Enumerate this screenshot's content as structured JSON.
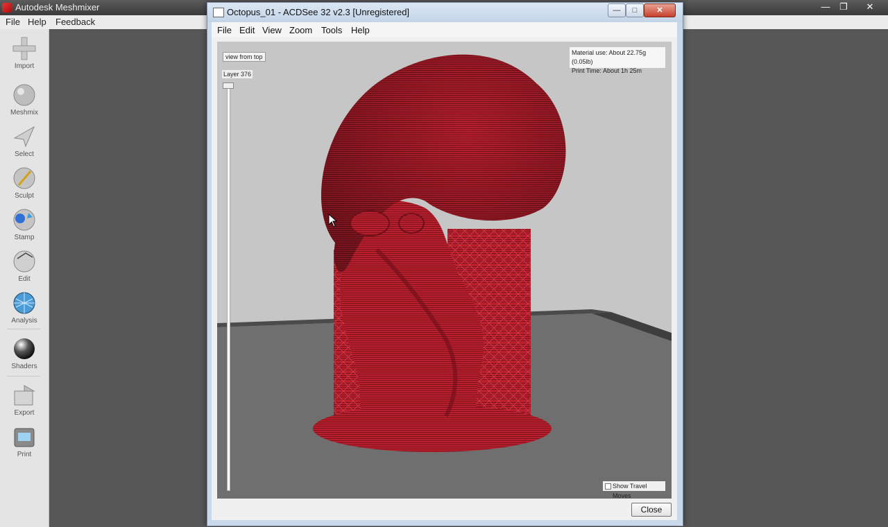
{
  "meshmixer": {
    "title": "Autodesk Meshmixer",
    "menu": [
      "File",
      "Help",
      "Feedback"
    ],
    "tools": [
      {
        "label": "Import",
        "icon": "plus-icon"
      },
      {
        "label": "Meshmix",
        "icon": "meshmix-icon"
      },
      {
        "label": "Select",
        "icon": "select-arrow-icon"
      },
      {
        "label": "Sculpt",
        "icon": "sculpt-brush-icon"
      },
      {
        "label": "Stamp",
        "icon": "stamp-icon"
      },
      {
        "label": "Edit",
        "icon": "edit-sphere-icon"
      },
      {
        "label": "Analysis",
        "icon": "analysis-icon"
      },
      {
        "label": "Shaders",
        "icon": "shaders-icon"
      },
      {
        "label": "Export",
        "icon": "export-icon"
      },
      {
        "label": "Print",
        "icon": "print-icon"
      }
    ]
  },
  "dialog": {
    "title": "Octopus_01 - ACDSee 32 v2.3 [Unregistered]",
    "menu": [
      "File",
      "Edit",
      "View",
      "Zoom",
      "Tools",
      "Help"
    ],
    "view_button": "view from top",
    "layer_label": "Layer 376",
    "material_use": "Material use: About 22.75g (0.05lb)",
    "print_time": "Print Time: About 1h 25m",
    "travel_moves": "Show Travel Moves",
    "close_button": "Close",
    "colors": {
      "model": "#b8202e",
      "platform": "#6e6e6e",
      "background": "#c6c6c6"
    }
  }
}
